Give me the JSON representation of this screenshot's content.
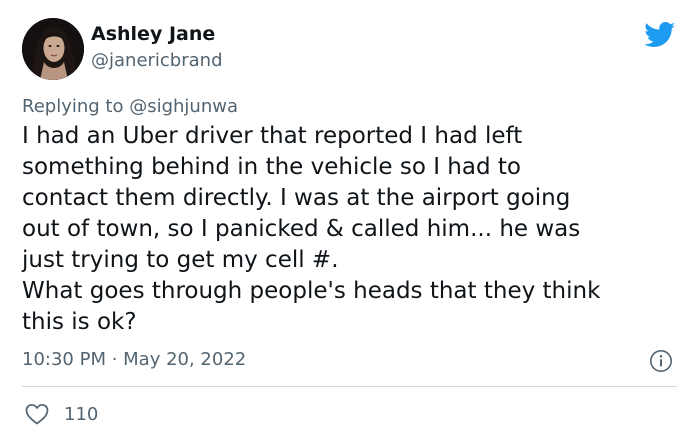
{
  "author": {
    "display_name": "Ashley Jane",
    "handle": "@janericbrand"
  },
  "reply": {
    "prefix": "Replying to ",
    "mention": "@sighjunwa"
  },
  "tweet": {
    "lines": [
      "I had an Uber driver that reported I had left",
      "something behind in the vehicle so I had to",
      "contact them directly. I was at the airport going",
      "out of town, so I panicked & called him... he was",
      "just trying to get my cell #.",
      "What goes through people's heads that they think",
      "this is ok?"
    ]
  },
  "meta": {
    "timestamp": "10:30 PM · May 20, 2022"
  },
  "stats": {
    "likes": "110"
  },
  "icons": {
    "brand": "twitter-bird-icon",
    "info": "info-icon",
    "like": "heart-icon"
  },
  "colors": {
    "brand_blue": "#1d9bf0",
    "text_primary": "#0f1419",
    "text_secondary": "#536471",
    "divider": "#cfd9de"
  }
}
